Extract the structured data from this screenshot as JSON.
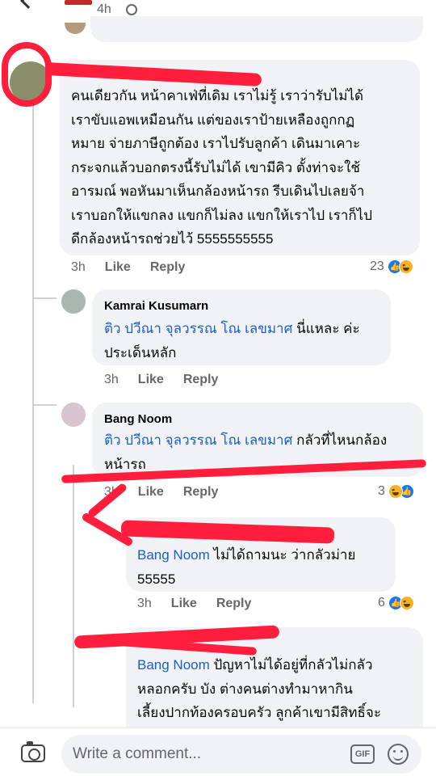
{
  "post": {
    "time": "4h"
  },
  "comment_main": {
    "lines": [
      "คนเดียวกัน หน้าคาเฟ่ที่เดิม เราไม่รู้ เราว่ารับไม่ได้",
      "เราขับแอพเหมือนกัน แต่ของเราป้ายเหลืองถูกกฏ",
      "หมาย จ่ายภาษีถูกต้อง เราไปรับลูกค้า เดินมาเคาะ",
      "กระจกแล้วบอกตรงนี้รับไม่ได้ เขามีคิว ตั้งท่าจะใช้",
      "อารมณ์ พอหันมาเห็นกล้องหน้ารถ รีบเดินไปเลยจ้า",
      "เราบอกให้แขกลง แขกก็ไม่ลง แขกให้เราไป เราก็ไป",
      "ดีกล้องหน้ารถช่วยไว้ 5555555555"
    ],
    "time": "3h",
    "like": "Like",
    "reply": "Reply",
    "reactions": "23"
  },
  "reply1": {
    "author": "Kamrai Kusumarn",
    "mention": "ติว ปวีณา จุลวรรณ โณ เลขมาศ",
    "text_after_mention": " นี่แหละ ค่ะ",
    "line2": "ประเด็นหลัก",
    "time": "3h",
    "like": "Like",
    "reply": "Reply"
  },
  "reply2": {
    "author": "Bang Noom",
    "mention": "ติว ปวีณา จุลวรรณ โณ เลขมาศ",
    "text_after_mention": " กลัวที่ไหนกล้อง",
    "line2": "หน้ารถ",
    "time": "3h",
    "like": "Like",
    "reply": "Reply",
    "reactions": "3"
  },
  "reply3": {
    "mention": "Bang Noom",
    "text_after_mention": " ไม่ได้ถามนะ ว่ากลัวม่าย",
    "line2": "55555",
    "time": "3h",
    "like": "Like",
    "reply": "Reply",
    "reactions": "6"
  },
  "reply4": {
    "mention": "Bang Noom",
    "text_after_mention": " ปัญหาไม่ได้อยู่ที่กลัวไม่กลัว",
    "line2": "หลอกครับ บัง ต่างคนต่างทำมาหากิน",
    "line3": "เลี้ยงปากท้องครอบครัว ลูกค้าเขามีสิทธิ์จะ"
  },
  "composer": {
    "placeholder": "Write a comment...",
    "gif": "GIF"
  }
}
